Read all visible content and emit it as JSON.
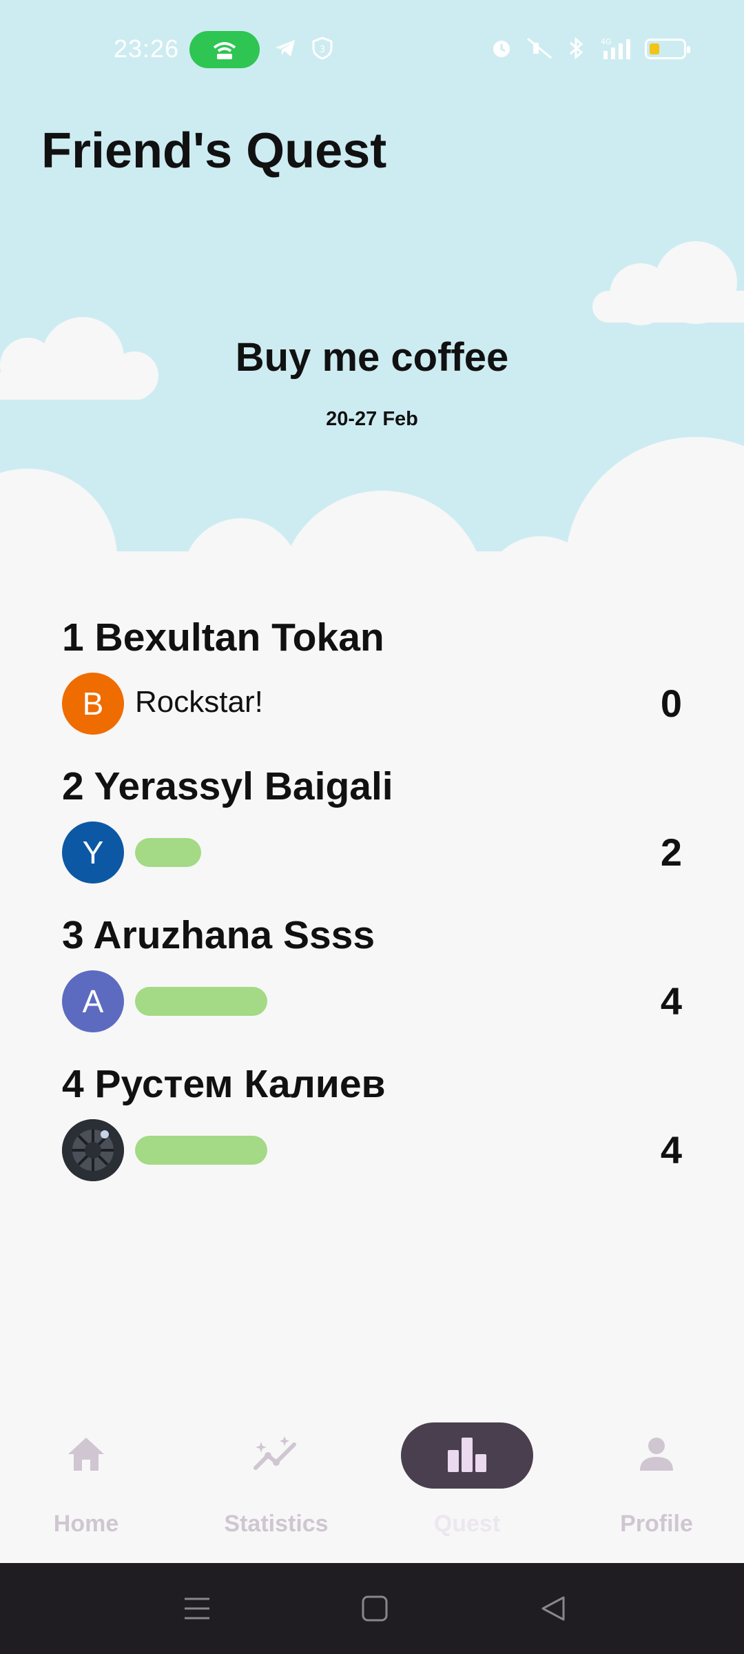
{
  "status_bar": {
    "time": "23:26",
    "icons": [
      "wifi-hotspot-icon",
      "telegram-icon",
      "shield-icon",
      "alarm-icon",
      "mute-icon",
      "bluetooth-icon",
      "signal-4g-icon",
      "battery-icon"
    ]
  },
  "header": {
    "app_title": "Friend's Quest",
    "quest_title": "Buy me coffee",
    "quest_dates": "20-27 Feb"
  },
  "leaderboard": [
    {
      "rank_name": "1 Bexultan Tokan",
      "initial": "B",
      "avatar_color": "#EF6C00",
      "status_text": "Rockstar!",
      "progress": 0,
      "score": "0"
    },
    {
      "rank_name": "2 Yerassyl Baigali",
      "initial": "Y",
      "avatar_color": "#0D58A5",
      "status_text": "",
      "progress": 0.5,
      "score": "2"
    },
    {
      "rank_name": "3 Aruzhana Ssss",
      "initial": "A",
      "avatar_color": "#5C6BC0",
      "status_text": "",
      "progress": 1.0,
      "score": "4"
    },
    {
      "rank_name": "4 Рустем Калиев",
      "initial": "",
      "avatar_color": "#2A2E35",
      "status_text": "",
      "progress": 1.0,
      "score": "4"
    }
  ],
  "bottom_nav": {
    "items": [
      {
        "label": "Home",
        "icon": "home-icon"
      },
      {
        "label": "Statistics",
        "icon": "statistics-icon"
      },
      {
        "label": "Quest",
        "icon": "leaderboard-icon",
        "active": true
      },
      {
        "label": "Profile",
        "icon": "profile-icon"
      }
    ]
  },
  "colors": {
    "sky": "#CDECF1",
    "background": "#F7F7F7",
    "progress": "#A4D985",
    "nav_active_pill": "#4A3F4F",
    "nav_inactive": "#D0C6D2"
  }
}
